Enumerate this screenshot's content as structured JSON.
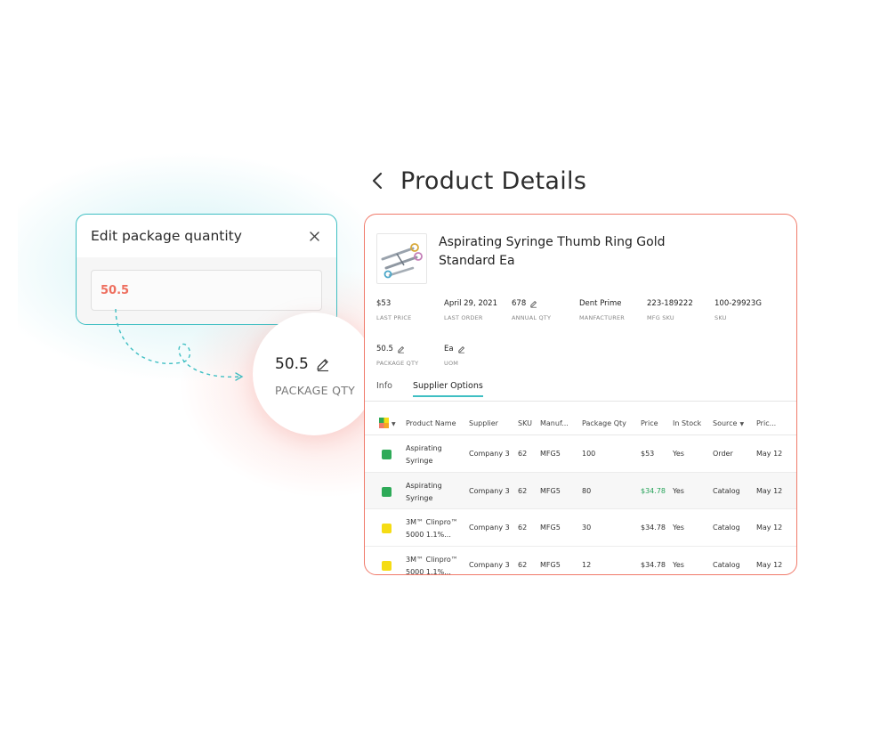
{
  "page": {
    "title": "Product Details",
    "back_icon": "chevron-left-icon"
  },
  "edit_dialog": {
    "title": "Edit package quantity",
    "close_icon": "close-icon",
    "value": "50.5"
  },
  "zoom": {
    "value": "50.5",
    "label": "PACKAGE QTY",
    "edit_icon": "pencil-icon"
  },
  "product": {
    "name": "Aspirating Syringe Thumb Ring Gold Standard Ea",
    "meta": [
      {
        "value": "$53",
        "label": "LAST PRICE",
        "editable": false
      },
      {
        "value": "April 29, 2021",
        "label": "LAST ORDER",
        "editable": false
      },
      {
        "value": "678",
        "label": "ANNUAL QTY",
        "editable": true
      },
      {
        "value": "Dent Prime",
        "label": "MANFACTURER",
        "editable": false
      },
      {
        "value": "223-189222",
        "label": "MFG SKU",
        "editable": false
      },
      {
        "value": "100-29923G",
        "label": "SKU",
        "editable": false
      },
      {
        "value": "50.5",
        "label": "PACKAGE QTY",
        "editable": true
      },
      {
        "value": "Ea",
        "label": "UOM",
        "editable": true
      }
    ]
  },
  "tabs": [
    {
      "label": "Info",
      "active": false
    },
    {
      "label": "Supplier Options",
      "active": true
    }
  ],
  "table": {
    "headers": [
      "Product Name",
      "Supplier",
      "SKU",
      "Manuf...",
      "Package Qty",
      "Price",
      "In Stock",
      "Source",
      "Pric..."
    ],
    "rows": [
      {
        "status_color": "#2eaa58",
        "name1": "Aspirating",
        "name2": "Syringe",
        "supplier": "Company 3",
        "sku": "62",
        "manuf": "MFG5",
        "pkg_qty": "100",
        "price": "$53",
        "price_highlight": false,
        "in_stock": "Yes",
        "source": "Order",
        "price_date": "May 12"
      },
      {
        "status_color": "#2eaa58",
        "name1": "Aspirating",
        "name2": "Syringe",
        "supplier": "Company 3",
        "sku": "62",
        "manuf": "MFG5",
        "pkg_qty": "80",
        "price": "$34.78",
        "price_highlight": true,
        "in_stock": "Yes",
        "source": "Catalog",
        "price_date": "May 12"
      },
      {
        "status_color": "#f5dc14",
        "name1": "3M™ Clinpro™",
        "name2": "5000 1.1%...",
        "supplier": "Company 3",
        "sku": "62",
        "manuf": "MFG5",
        "pkg_qty": "30",
        "price": "$34.78",
        "price_highlight": false,
        "in_stock": "Yes",
        "source": "Catalog",
        "price_date": "May 12"
      },
      {
        "status_color": "#f5dc14",
        "name1": "3M™ Clinpro™",
        "name2": "5000 1.1%...",
        "supplier": "Company 3",
        "sku": "62",
        "manuf": "MFG5",
        "pkg_qty": "12",
        "price": "$34.78",
        "price_highlight": false,
        "in_stock": "Yes",
        "source": "Catalog",
        "price_date": "May 12"
      }
    ]
  },
  "colors": {
    "teal_accent": "#3fbfc3",
    "coral_accent": "#f07a6a",
    "value_red": "#ee6f5f",
    "green_price": "#27a35a"
  }
}
